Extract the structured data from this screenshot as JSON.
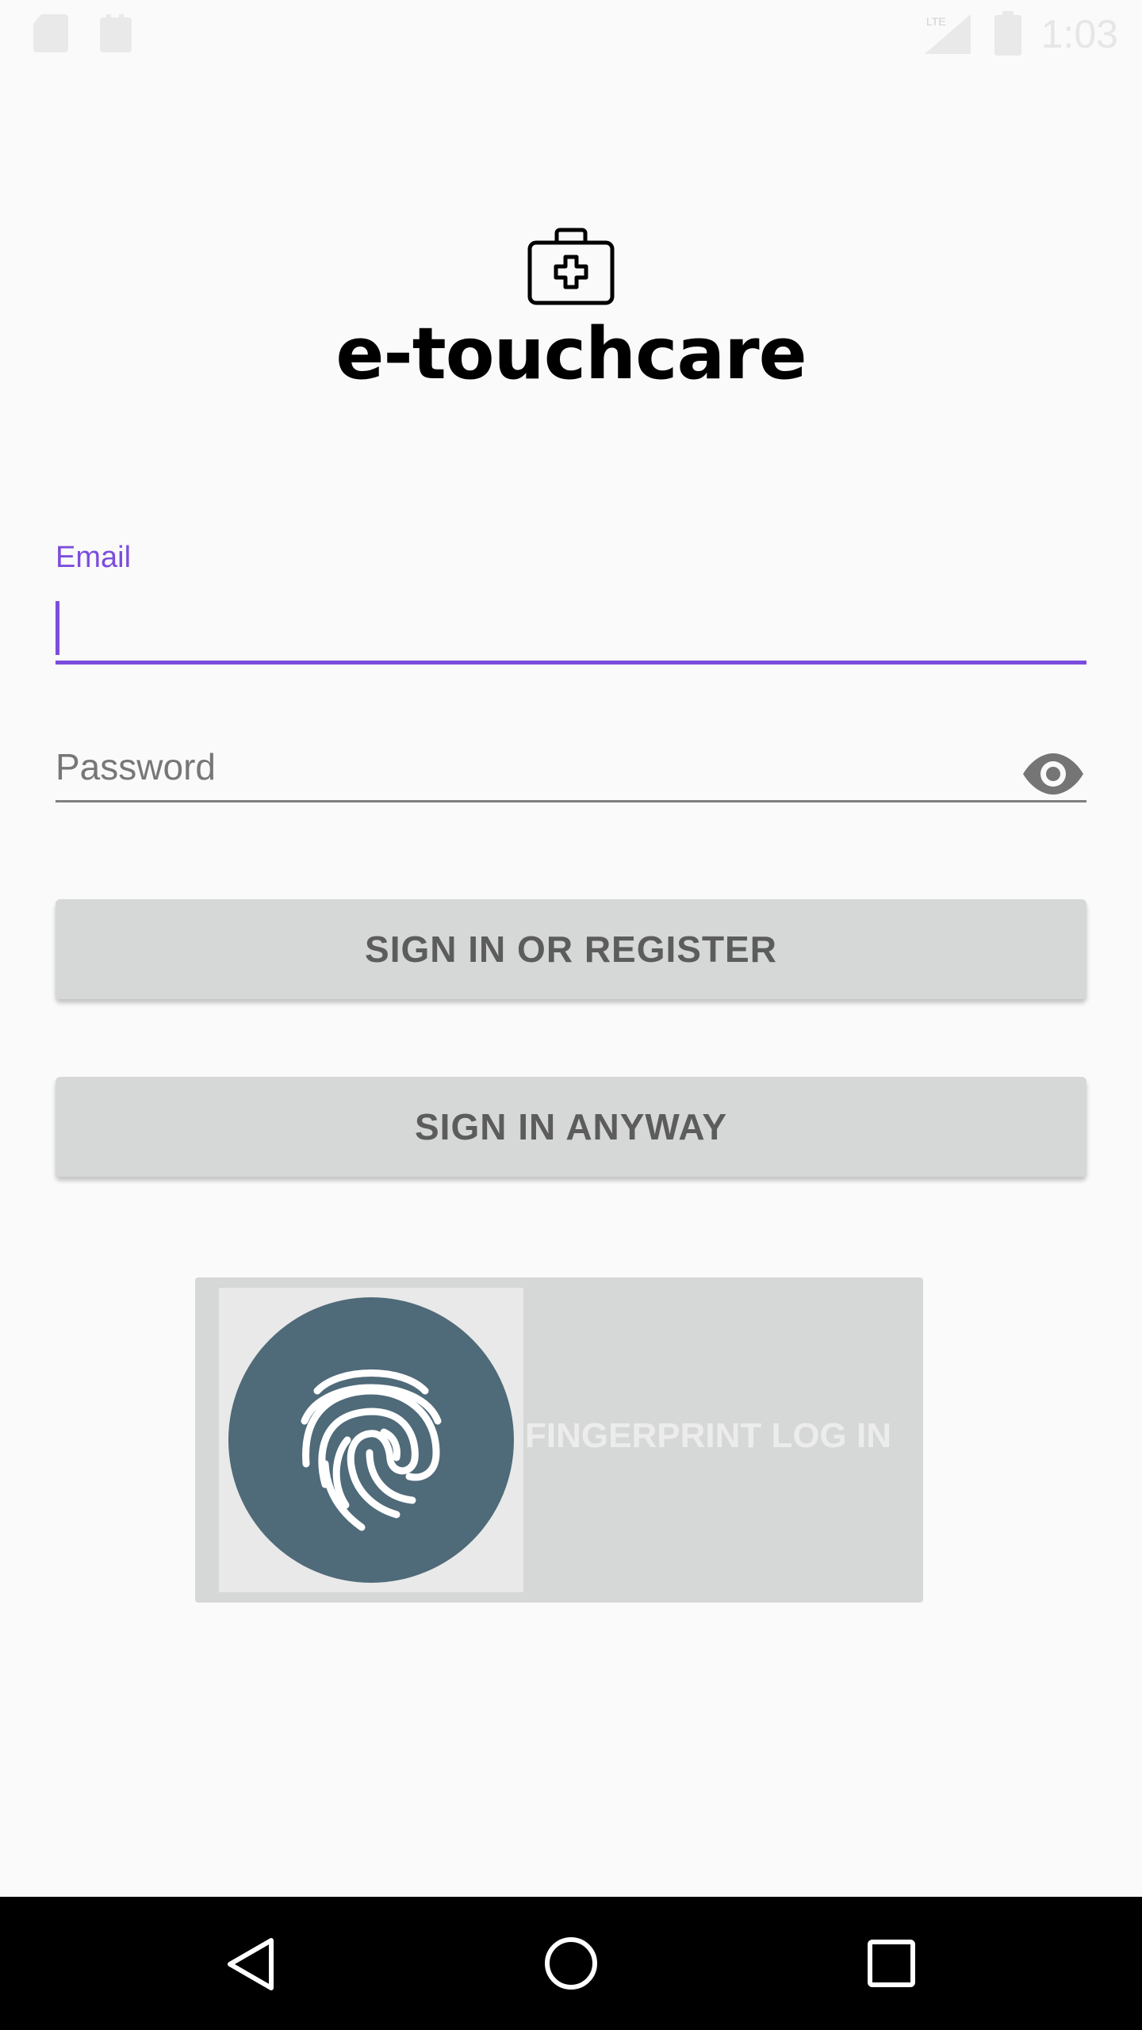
{
  "status_bar": {
    "time": "1:03",
    "icons": [
      "sd-card-icon",
      "sd-card-icon",
      "lte-signal-icon",
      "battery-icon"
    ]
  },
  "app": {
    "logo_icon": "medical-briefcase-icon",
    "title": "e-touchcare"
  },
  "form": {
    "email_label": "Email",
    "email_value": "",
    "password_placeholder": "Password",
    "password_toggle_icon": "eye-icon",
    "accent_color": "#7c4ddd"
  },
  "buttons": {
    "sign_in_register": "SIGN IN OR REGISTER",
    "sign_in_anyway": "SIGN IN ANYWAY",
    "fingerprint": "FINGERPRINT LOG IN"
  },
  "fingerprint": {
    "icon": "fingerprint-icon",
    "circle_color": "#4f6a79"
  },
  "nav_bar": {
    "back": "back-icon",
    "home": "home-icon",
    "recents": "recents-icon"
  }
}
